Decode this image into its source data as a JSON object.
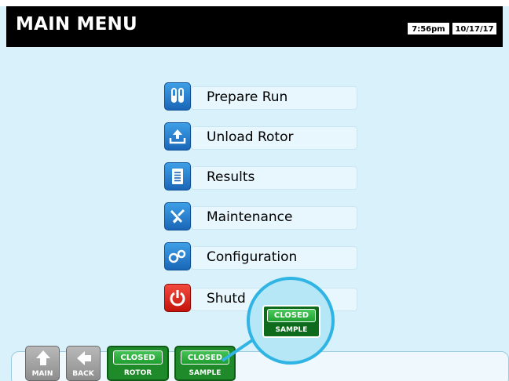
{
  "header": {
    "title": "MAIN MENU",
    "time": "7:56pm",
    "date": "10/17/17"
  },
  "menu": {
    "items": [
      {
        "label": "Prepare Run",
        "icon": "test-tubes-icon"
      },
      {
        "label": "Unload Rotor",
        "icon": "unload-tray-icon"
      },
      {
        "label": "Results",
        "icon": "document-icon"
      },
      {
        "label": "Maintenance",
        "icon": "tools-icon"
      },
      {
        "label": "Configuration",
        "icon": "gears-icon"
      },
      {
        "label": "Shutd",
        "icon": "power-icon"
      }
    ]
  },
  "bottom_bar": {
    "main_label": "MAIN",
    "back_label": "BACK",
    "rotor": {
      "state": "CLOSED",
      "label": "ROTOR"
    },
    "sample": {
      "state": "CLOSED",
      "label": "SAMPLE"
    }
  },
  "callout": {
    "state": "CLOSED",
    "label": "SAMPLE"
  },
  "colors": {
    "background": "#d9f1fb",
    "titlebar": "#000000",
    "icon_blue": "#1a66b8",
    "icon_red": "#c4130c",
    "status_green": "#1f8a2a",
    "callout_ring": "#2fb4e4"
  }
}
